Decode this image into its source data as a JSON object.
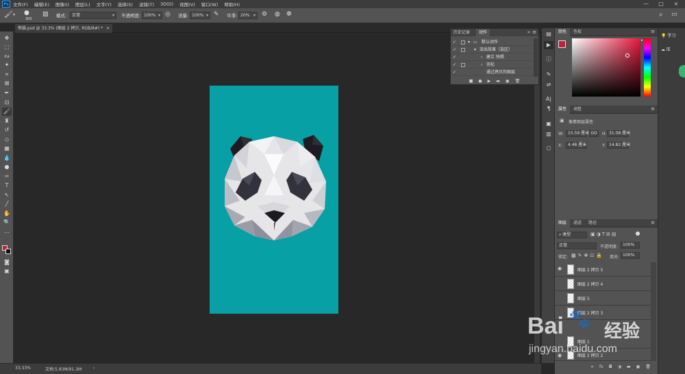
{
  "menu": {
    "logo": "Ps",
    "items": [
      "文件(F)",
      "编辑(E)",
      "图像(I)",
      "图层(L)",
      "文字(Y)",
      "选择(S)",
      "滤镜(T)",
      "3D(D)",
      "视图(V)",
      "窗口(W)",
      "帮助(H)"
    ],
    "window_controls": [
      "—",
      "□",
      "×"
    ]
  },
  "options": {
    "brush_size": "300",
    "mode_label": "模式:",
    "mode_value": "正常",
    "opacity_label": "不透明度:",
    "opacity_value": "100%",
    "flow_label": "流量:",
    "flow_value": "100%",
    "smoothing_label": "平滑:",
    "smoothing_value": "20%"
  },
  "document": {
    "tab_title": "熊猫.psd @ 33.3% (图层 2 拷贝, RGB/8#) *",
    "close": "×",
    "canvas_color": "#06a0a5"
  },
  "status": {
    "zoom": "33.33%",
    "doc_info": "文档:5.93M/91.3M",
    "arrow": "›"
  },
  "actions_panel": {
    "tabs": [
      "历史记录",
      "动作"
    ],
    "rows": [
      {
        "check": "✓",
        "text": "默认动作",
        "kind": "folder"
      },
      {
        "check": "✓",
        "text": "流出效果（选区）",
        "kind": "action"
      },
      {
        "check": "✓",
        "text": "建立 快照",
        "kind": "step"
      },
      {
        "check": "✓",
        "text": "羽化",
        "kind": "step"
      },
      {
        "check": "✓",
        "text": "通过拷贝的图层",
        "kind": "step"
      }
    ],
    "footer_icons": [
      "■",
      "●",
      "▶",
      "▬",
      "▣",
      "🗑"
    ]
  },
  "color_panel": {
    "tabs": [
      "颜色",
      "色板"
    ],
    "fg_color": "#c0203a",
    "bg_color": "#ffffff"
  },
  "properties_panel": {
    "tabs": [
      "属性",
      "调整"
    ],
    "title": "像素图层属性",
    "w_label": "W:",
    "w_value": "15.59 厘米",
    "link": "GO",
    "h_label": "H:",
    "h_value": "31.08 厘米",
    "x_label": "X:",
    "x_value": "4.48 厘米",
    "y_label": "Y:",
    "y_value": "14.82 厘米"
  },
  "layers_panel": {
    "tabs": [
      "图层",
      "通道",
      "路径"
    ],
    "filter_label": "类型",
    "blend_mode": "正常",
    "opacity_label": "不透明度:",
    "opacity_value": "100%",
    "lock_label": "锁定:",
    "fill_label": "填充:",
    "fill_value": "100%",
    "layers": [
      {
        "name": "图层 2 拷贝 5",
        "visible": true
      },
      {
        "name": "图层 2 拷贝 4",
        "visible": false
      },
      {
        "name": "图层 5",
        "visible": false
      },
      {
        "name": "图层 2 拷贝 3",
        "visible": false
      },
      {
        "name": "图层 1",
        "visible": false
      },
      {
        "name": "图层 2 拷贝 2",
        "visible": true
      }
    ],
    "footer_icons": [
      "∞",
      "fx",
      "◘",
      "◑",
      "▬",
      "▣",
      "🗑"
    ]
  },
  "learn_panel": {
    "items": [
      "学习",
      "库"
    ]
  },
  "watermark": {
    "brand": "Bai",
    "brand2": "经验",
    "url": "jingyan.baidu.com"
  }
}
